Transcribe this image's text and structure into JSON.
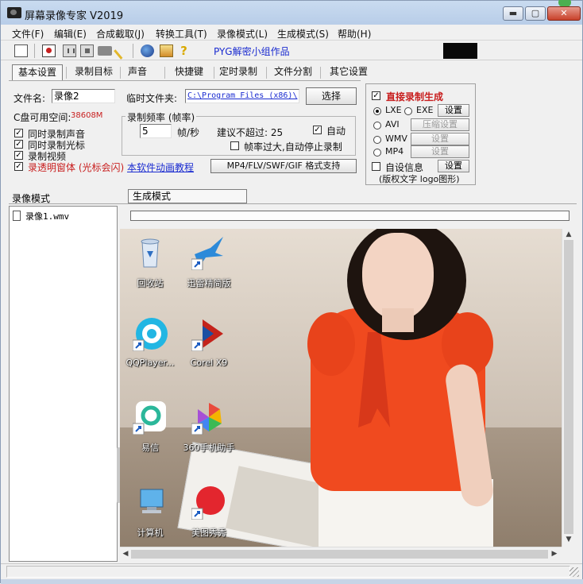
{
  "window": {
    "title": "屏幕录像专家 V2019",
    "min": "▬",
    "max": "▢",
    "close": "✕"
  },
  "menu": [
    "文件(F)",
    "编辑(E)",
    "合成截取(J)",
    "转换工具(T)",
    "录像模式(L)",
    "生成模式(S)",
    "帮助(H)"
  ],
  "toolbar": {
    "label": "PYG解密小组作品",
    "icons": [
      "new-icon",
      "record-icon",
      "pause-icon",
      "stop-icon",
      "camera-icon",
      "pen-icon",
      "globe-icon",
      "package-icon",
      "help-icon"
    ]
  },
  "tabs": [
    "基本设置",
    "录制目标",
    "声音",
    "快捷键",
    "定时录制",
    "文件分割",
    "其它设置"
  ],
  "basic": {
    "filename_label": "文件名:",
    "filename_value": "录像2",
    "tempdir_label": "临时文件夹:",
    "tempdir_value": "C:\\Program Files (x86)\\",
    "choose_button": "选择",
    "disk_label": "C盘可用空间:",
    "disk_value": "38608M",
    "checks": [
      {
        "label": "同时录制声音",
        "checked": true
      },
      {
        "label": "同时录制光标",
        "checked": true
      },
      {
        "label": "录制视频",
        "checked": true
      },
      {
        "label": "录透明窗体 (光标会闪)",
        "checked": true
      }
    ],
    "framerate": {
      "title": "录制频率 (帧率)",
      "value": "5",
      "unit": "帧/秒",
      "suggest": "建议不超过: 25",
      "auto_label": "自动",
      "auto_checked": true,
      "auto_stop_label": "帧率过大,自动停止录制",
      "auto_stop_checked": false
    },
    "tutorial_link": "本软件动画教程",
    "format_button": "MP4/FLV/SWF/GIF  格式支持"
  },
  "output": {
    "direct_label": "直接录制生成",
    "direct_checked": true,
    "formats": [
      {
        "label": "LXE",
        "selected": true
      },
      {
        "label": "EXE",
        "selected": false
      },
      {
        "label": "AVI",
        "selected": false
      },
      {
        "label": "WMV",
        "selected": false
      },
      {
        "label": "MP4",
        "selected": false
      }
    ],
    "settings_label": "设置",
    "compress_label": "压缩设置",
    "autoinfo_label": "自设信息",
    "autoinfo_checked": false,
    "copyright_label": "(版权文字 logo图形)"
  },
  "bottom": {
    "record_mode_label": "录像模式",
    "gen_mode_tab": "生成模式",
    "files": [
      "录像1.wmv"
    ]
  },
  "desktop_icons": [
    {
      "name": "recycle-bin-icon",
      "label": "回收站"
    },
    {
      "name": "xunlei-icon",
      "label": "迅雷精简版"
    },
    {
      "name": "qqplayer-icon",
      "label": "QQPlayer..."
    },
    {
      "name": "corel-icon",
      "label": "Corel X9"
    },
    {
      "name": "yixin-icon",
      "label": "易信"
    },
    {
      "name": "360-icon",
      "label": "360手机助手"
    },
    {
      "name": "computer-icon",
      "label": "计算机"
    },
    {
      "name": "meitu-icon",
      "label": "美图秀秀"
    }
  ],
  "colors": {
    "link": "#1a2bd0",
    "red_text": "#c81e1e",
    "accent_shirt": "#f04a1f"
  }
}
